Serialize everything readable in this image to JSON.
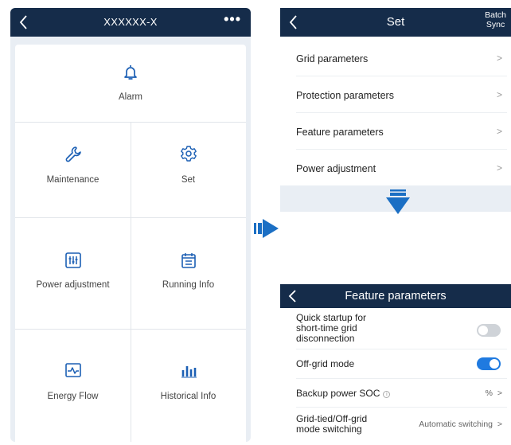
{
  "left_screen": {
    "header": {
      "title": "XXXXXX-X",
      "more_label": "•••"
    },
    "tiles": [
      {
        "label": "Alarm",
        "icon": "bell-icon"
      },
      {
        "label": "Maintenance",
        "icon": "wrench-icon"
      },
      {
        "label": "Set",
        "icon": "gear-icon"
      },
      {
        "label": "Power adjustment",
        "icon": "sliders-icon"
      },
      {
        "label": "Running Info",
        "icon": "calendar-list-icon"
      },
      {
        "label": "Energy Flow",
        "icon": "pulse-icon"
      },
      {
        "label": "Historical Info",
        "icon": "bar-chart-icon"
      }
    ]
  },
  "set_screen": {
    "header": {
      "title": "Set",
      "batch_line1": "Batch",
      "batch_line2": "Sync"
    },
    "rows": [
      {
        "label": "Grid parameters",
        "chevron": ">"
      },
      {
        "label": "Protection parameters",
        "chevron": ">"
      },
      {
        "label": "Feature parameters",
        "chevron": ">"
      },
      {
        "label": "Power adjustment",
        "chevron": ">"
      }
    ]
  },
  "feature_screen": {
    "header": {
      "title": "Feature parameters"
    },
    "rows": [
      {
        "label_lines": [
          "Quick startup for",
          "short-time grid",
          "disconnection"
        ],
        "toggle": "off"
      },
      {
        "label": "Off-grid mode",
        "toggle": "on"
      },
      {
        "label": "Backup power SOC",
        "info_glyph": "i",
        "value": "%",
        "chevron": ">"
      },
      {
        "label_lines": [
          "Grid-tied/Off-grid",
          "mode switching"
        ],
        "value": "Automatic switching",
        "chevron": ">"
      }
    ]
  },
  "colors": {
    "header_bg": "#152c4a",
    "accent_blue": "#1f7ae0",
    "icon_blue": "#1b5fb4",
    "page_bg": "#e9eef4"
  }
}
